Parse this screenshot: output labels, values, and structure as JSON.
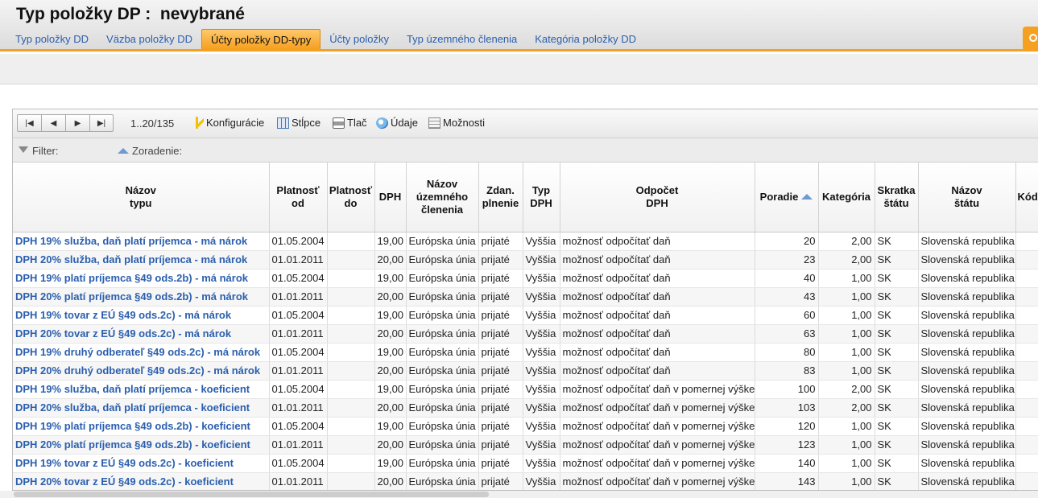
{
  "header": {
    "title": "Typ položky DP :  nevybrané",
    "tabs": [
      {
        "label": "Typ položky DD",
        "active": false
      },
      {
        "label": "Väzba položky DD",
        "active": false
      },
      {
        "label": "Účty položky DD-typy",
        "active": true
      },
      {
        "label": "Účty položky",
        "active": false
      },
      {
        "label": "Typ územného členenia",
        "active": false
      },
      {
        "label": "Kategória položky DD",
        "active": false
      }
    ],
    "accent_color": "#f5a020"
  },
  "toolbar": {
    "range": "1..20/135",
    "items": [
      {
        "label": "Konfigurácie",
        "icon": "lightning-icon"
      },
      {
        "label": "Stĺpce",
        "icon": "columns-icon"
      },
      {
        "label": "Tlač",
        "icon": "printer-icon"
      },
      {
        "label": "Údaje",
        "icon": "data-disk-icon"
      },
      {
        "label": "Možnosti",
        "icon": "options-icon"
      }
    ]
  },
  "filterbar": {
    "filter_label": "Filter:",
    "sort_label": "Zoradenie:"
  },
  "table": {
    "columns": [
      "Názov typu",
      "Platnosť od",
      "Platnosť do",
      "DPH",
      "Názov územného členenia",
      "Zdan. plnenie",
      "Typ DPH",
      "Odpočet DPH",
      "Poradie",
      "Kategória",
      "Skratka štátu",
      "Názov štátu",
      "Kód"
    ],
    "rows": [
      [
        "DPH 19% služba, daň platí príjemca - má nárok",
        "01.05.2004",
        "",
        "19,00",
        "Európska únia",
        "prijaté",
        "Vyššia",
        "možnosť odpočítať daň",
        "20",
        "2,00",
        "SK",
        "Slovenská republika",
        ""
      ],
      [
        "DPH 20% služba, daň platí príjemca - má nárok",
        "01.01.2011",
        "",
        "20,00",
        "Európska únia",
        "prijaté",
        "Vyššia",
        "možnosť odpočítať daň",
        "23",
        "2,00",
        "SK",
        "Slovenská republika",
        ""
      ],
      [
        "DPH 19% platí príjemca §49 ods.2b) - má nárok",
        "01.05.2004",
        "",
        "19,00",
        "Európska únia",
        "prijaté",
        "Vyššia",
        "možnosť odpočítať daň",
        "40",
        "1,00",
        "SK",
        "Slovenská republika",
        ""
      ],
      [
        "DPH 20% platí príjemca §49 ods.2b) - má nárok",
        "01.01.2011",
        "",
        "20,00",
        "Európska únia",
        "prijaté",
        "Vyššia",
        "možnosť odpočítať daň",
        "43",
        "1,00",
        "SK",
        "Slovenská republika",
        ""
      ],
      [
        "DPH 19% tovar z EÚ §49 ods.2c) - má nárok",
        "01.05.2004",
        "",
        "19,00",
        "Európska únia",
        "prijaté",
        "Vyššia",
        "možnosť odpočítať daň",
        "60",
        "1,00",
        "SK",
        "Slovenská republika",
        ""
      ],
      [
        "DPH 20% tovar z EÚ §49 ods.2c) - má nárok",
        "01.01.2011",
        "",
        "20,00",
        "Európska únia",
        "prijaté",
        "Vyššia",
        "možnosť odpočítať daň",
        "63",
        "1,00",
        "SK",
        "Slovenská republika",
        ""
      ],
      [
        "DPH 19% druhý odberateľ §49 ods.2c) - má nárok",
        "01.05.2004",
        "",
        "19,00",
        "Európska únia",
        "prijaté",
        "Vyššia",
        "možnosť odpočítať daň",
        "80",
        "1,00",
        "SK",
        "Slovenská republika",
        ""
      ],
      [
        "DPH 20% druhý odberateľ §49 ods.2c) - má nárok",
        "01.01.2011",
        "",
        "20,00",
        "Európska únia",
        "prijaté",
        "Vyššia",
        "možnosť odpočítať daň",
        "83",
        "1,00",
        "SK",
        "Slovenská republika",
        ""
      ],
      [
        "DPH 19% služba, daň platí príjemca - koeficient",
        "01.05.2004",
        "",
        "19,00",
        "Európska únia",
        "prijaté",
        "Vyššia",
        "možnosť odpočítať daň v pomernej výške",
        "100",
        "2,00",
        "SK",
        "Slovenská republika",
        ""
      ],
      [
        "DPH 20% služba, daň platí príjemca - koeficient",
        "01.01.2011",
        "",
        "20,00",
        "Európska únia",
        "prijaté",
        "Vyššia",
        "možnosť odpočítať daň v pomernej výške",
        "103",
        "2,00",
        "SK",
        "Slovenská republika",
        ""
      ],
      [
        "DPH 19% platí príjemca §49 ods.2b) - koeficient",
        "01.05.2004",
        "",
        "19,00",
        "Európska únia",
        "prijaté",
        "Vyššia",
        "možnosť odpočítať daň v pomernej výške",
        "120",
        "1,00",
        "SK",
        "Slovenská republika",
        ""
      ],
      [
        "DPH 20% platí príjemca §49 ods.2b) - koeficient",
        "01.01.2011",
        "",
        "20,00",
        "Európska únia",
        "prijaté",
        "Vyššia",
        "možnosť odpočítať daň v pomernej výške",
        "123",
        "1,00",
        "SK",
        "Slovenská republika",
        ""
      ],
      [
        "DPH 19% tovar z EÚ §49 ods.2c) - koeficient",
        "01.05.2004",
        "",
        "19,00",
        "Európska únia",
        "prijaté",
        "Vyššia",
        "možnosť odpočítať daň v pomernej výške",
        "140",
        "1,00",
        "SK",
        "Slovenská republika",
        ""
      ],
      [
        "DPH 20% tovar z EÚ §49 ods.2c) - koeficient",
        "01.01.2011",
        "",
        "20,00",
        "Európska únia",
        "prijaté",
        "Vyššia",
        "možnosť odpočítať daň v pomernej výške",
        "143",
        "1,00",
        "SK",
        "Slovenská republika",
        ""
      ]
    ]
  }
}
